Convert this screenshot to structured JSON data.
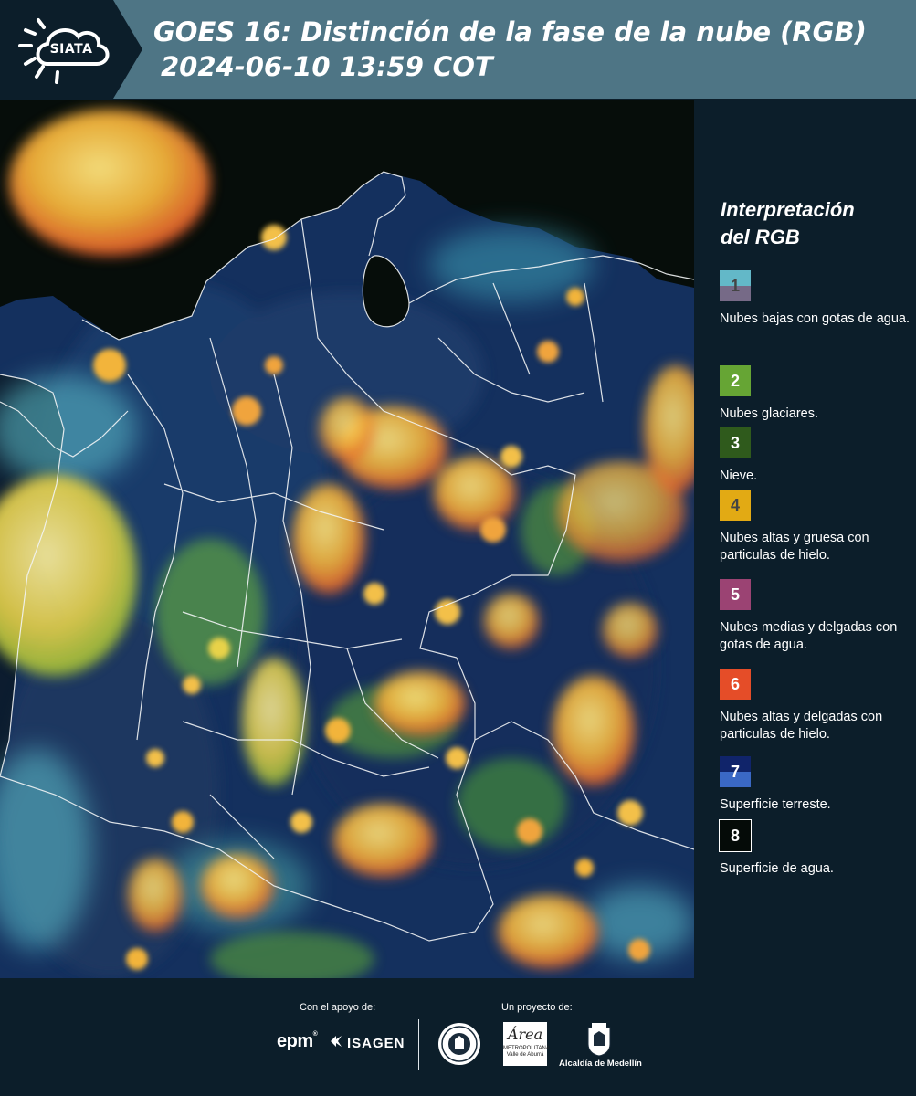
{
  "header": {
    "logo_text": "SIATA",
    "title_line1": "GOES 16: Distinción de la fase de la nube (RGB)",
    "title_line2": "2024-06-10 13:59 COT"
  },
  "legend": {
    "title": "Interpretación\ndel RGB",
    "items": [
      {
        "number": "1",
        "label": "Nubes bajas con gotas de agua.",
        "color_top": "#63b8c8",
        "color_bottom": "#766a87",
        "number_color": "#444444"
      },
      {
        "number": "2",
        "label": "Nubes glaciares.",
        "color_top": "#66a534",
        "color_bottom": "#66a534",
        "number_color": "#ffffff"
      },
      {
        "number": "3",
        "label": "Nieve.",
        "color_top": "#2f5a1c",
        "color_bottom": "#2f5a1c",
        "number_color": "#ffffff"
      },
      {
        "number": "4",
        "label": "Nubes altas y gruesa con particulas de hielo.",
        "color_top": "#e2aa14",
        "color_bottom": "#e2aa14",
        "number_color": "#444444"
      },
      {
        "number": "5",
        "label": "Nubes medias y delgadas con gotas de agua.",
        "color_top": "#9b4373",
        "color_bottom": "#9b4373",
        "number_color": "#ffffff"
      },
      {
        "number": "6",
        "label": "Nubes altas y delgadas con particulas de hielo.",
        "color_top": "#e54d28",
        "color_bottom": "#e54d28",
        "number_color": "#ffffff"
      },
      {
        "number": "7",
        "label": "Superficie terreste.",
        "color_top": "#10246a",
        "color_bottom": "#3a68c4",
        "number_color": "#ffffff"
      },
      {
        "number": "8",
        "label": "Superficie de agua.",
        "color_top": "#050b08",
        "color_bottom": "#050b08",
        "number_color": "#ffffff"
      }
    ]
  },
  "footer": {
    "support_label": "Con el apoyo de:",
    "project_label": "Un proyecto de:",
    "epm_logo": "epm",
    "isagen_logo": "ISAGEN",
    "area_logo_text": "Área",
    "area_logo_sub": "METROPOLITANA Valle de Aburrá",
    "alcaldia_label": "Alcaldía de Medellín"
  },
  "colors": {
    "header_bg": "#4e7585",
    "logo_tab_bg": "#0c1e2a",
    "panel_bg": "#0c1e2a",
    "ocean": "#050b08",
    "land_surface": "#10246a",
    "cloud_yellow": "#e2aa14",
    "cloud_orange": "#e54d28"
  }
}
